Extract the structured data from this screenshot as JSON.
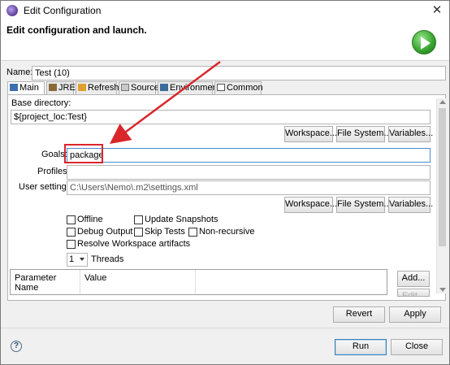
{
  "window": {
    "title": "Edit Configuration",
    "close_glyph": "✕"
  },
  "header": {
    "heading": "Edit configuration and launch."
  },
  "name_field": {
    "label": "Name:",
    "value": "Test (10)"
  },
  "tabs": [
    {
      "label": "Main",
      "icon": "main-tab-icon",
      "active": true
    },
    {
      "label": "JRE",
      "icon": "jre-icon"
    },
    {
      "label": "Refresh",
      "icon": "refresh-icon"
    },
    {
      "label": "Source",
      "icon": "source-icon"
    },
    {
      "label": "Environment",
      "icon": "environment-icon"
    },
    {
      "label": "Common",
      "icon": "common-icon"
    }
  ],
  "main": {
    "base_dir_label": "Base directory:",
    "base_dir_value": "${project_loc:Test}",
    "workspace_btn": "Workspace...",
    "filesystem_btn": "File System...",
    "variables_btn": "Variables...",
    "goals_label": "Goals:",
    "goals_value": "package",
    "profiles_label": "Profiles:",
    "profiles_value": "",
    "user_settings_label": "User settings:",
    "user_settings_value": "C:\\Users\\Nemo\\.m2\\settings.xml",
    "workspace_btn2": "Workspace...",
    "filesystem_btn2": "File System...",
    "variables_btn2": "Variables...",
    "checkboxes": {
      "offline": "Offline",
      "update_snapshots": "Update Snapshots",
      "debug_output": "Debug Output",
      "skip_tests": "Skip Tests",
      "non_recursive": "Non-recursive",
      "resolve_workspace": "Resolve Workspace artifacts"
    },
    "threads_value": "1",
    "threads_label": "Threads",
    "table_headers": [
      "Parameter Name",
      "Value"
    ],
    "add_btn": "Add...",
    "edit_btn": "Edit..."
  },
  "actions": {
    "revert": "Revert",
    "apply": "Apply",
    "run": "Run",
    "close": "Close",
    "help": "?"
  },
  "colors": {
    "annotation": "#d9262b",
    "accent": "#3c7fb1"
  }
}
